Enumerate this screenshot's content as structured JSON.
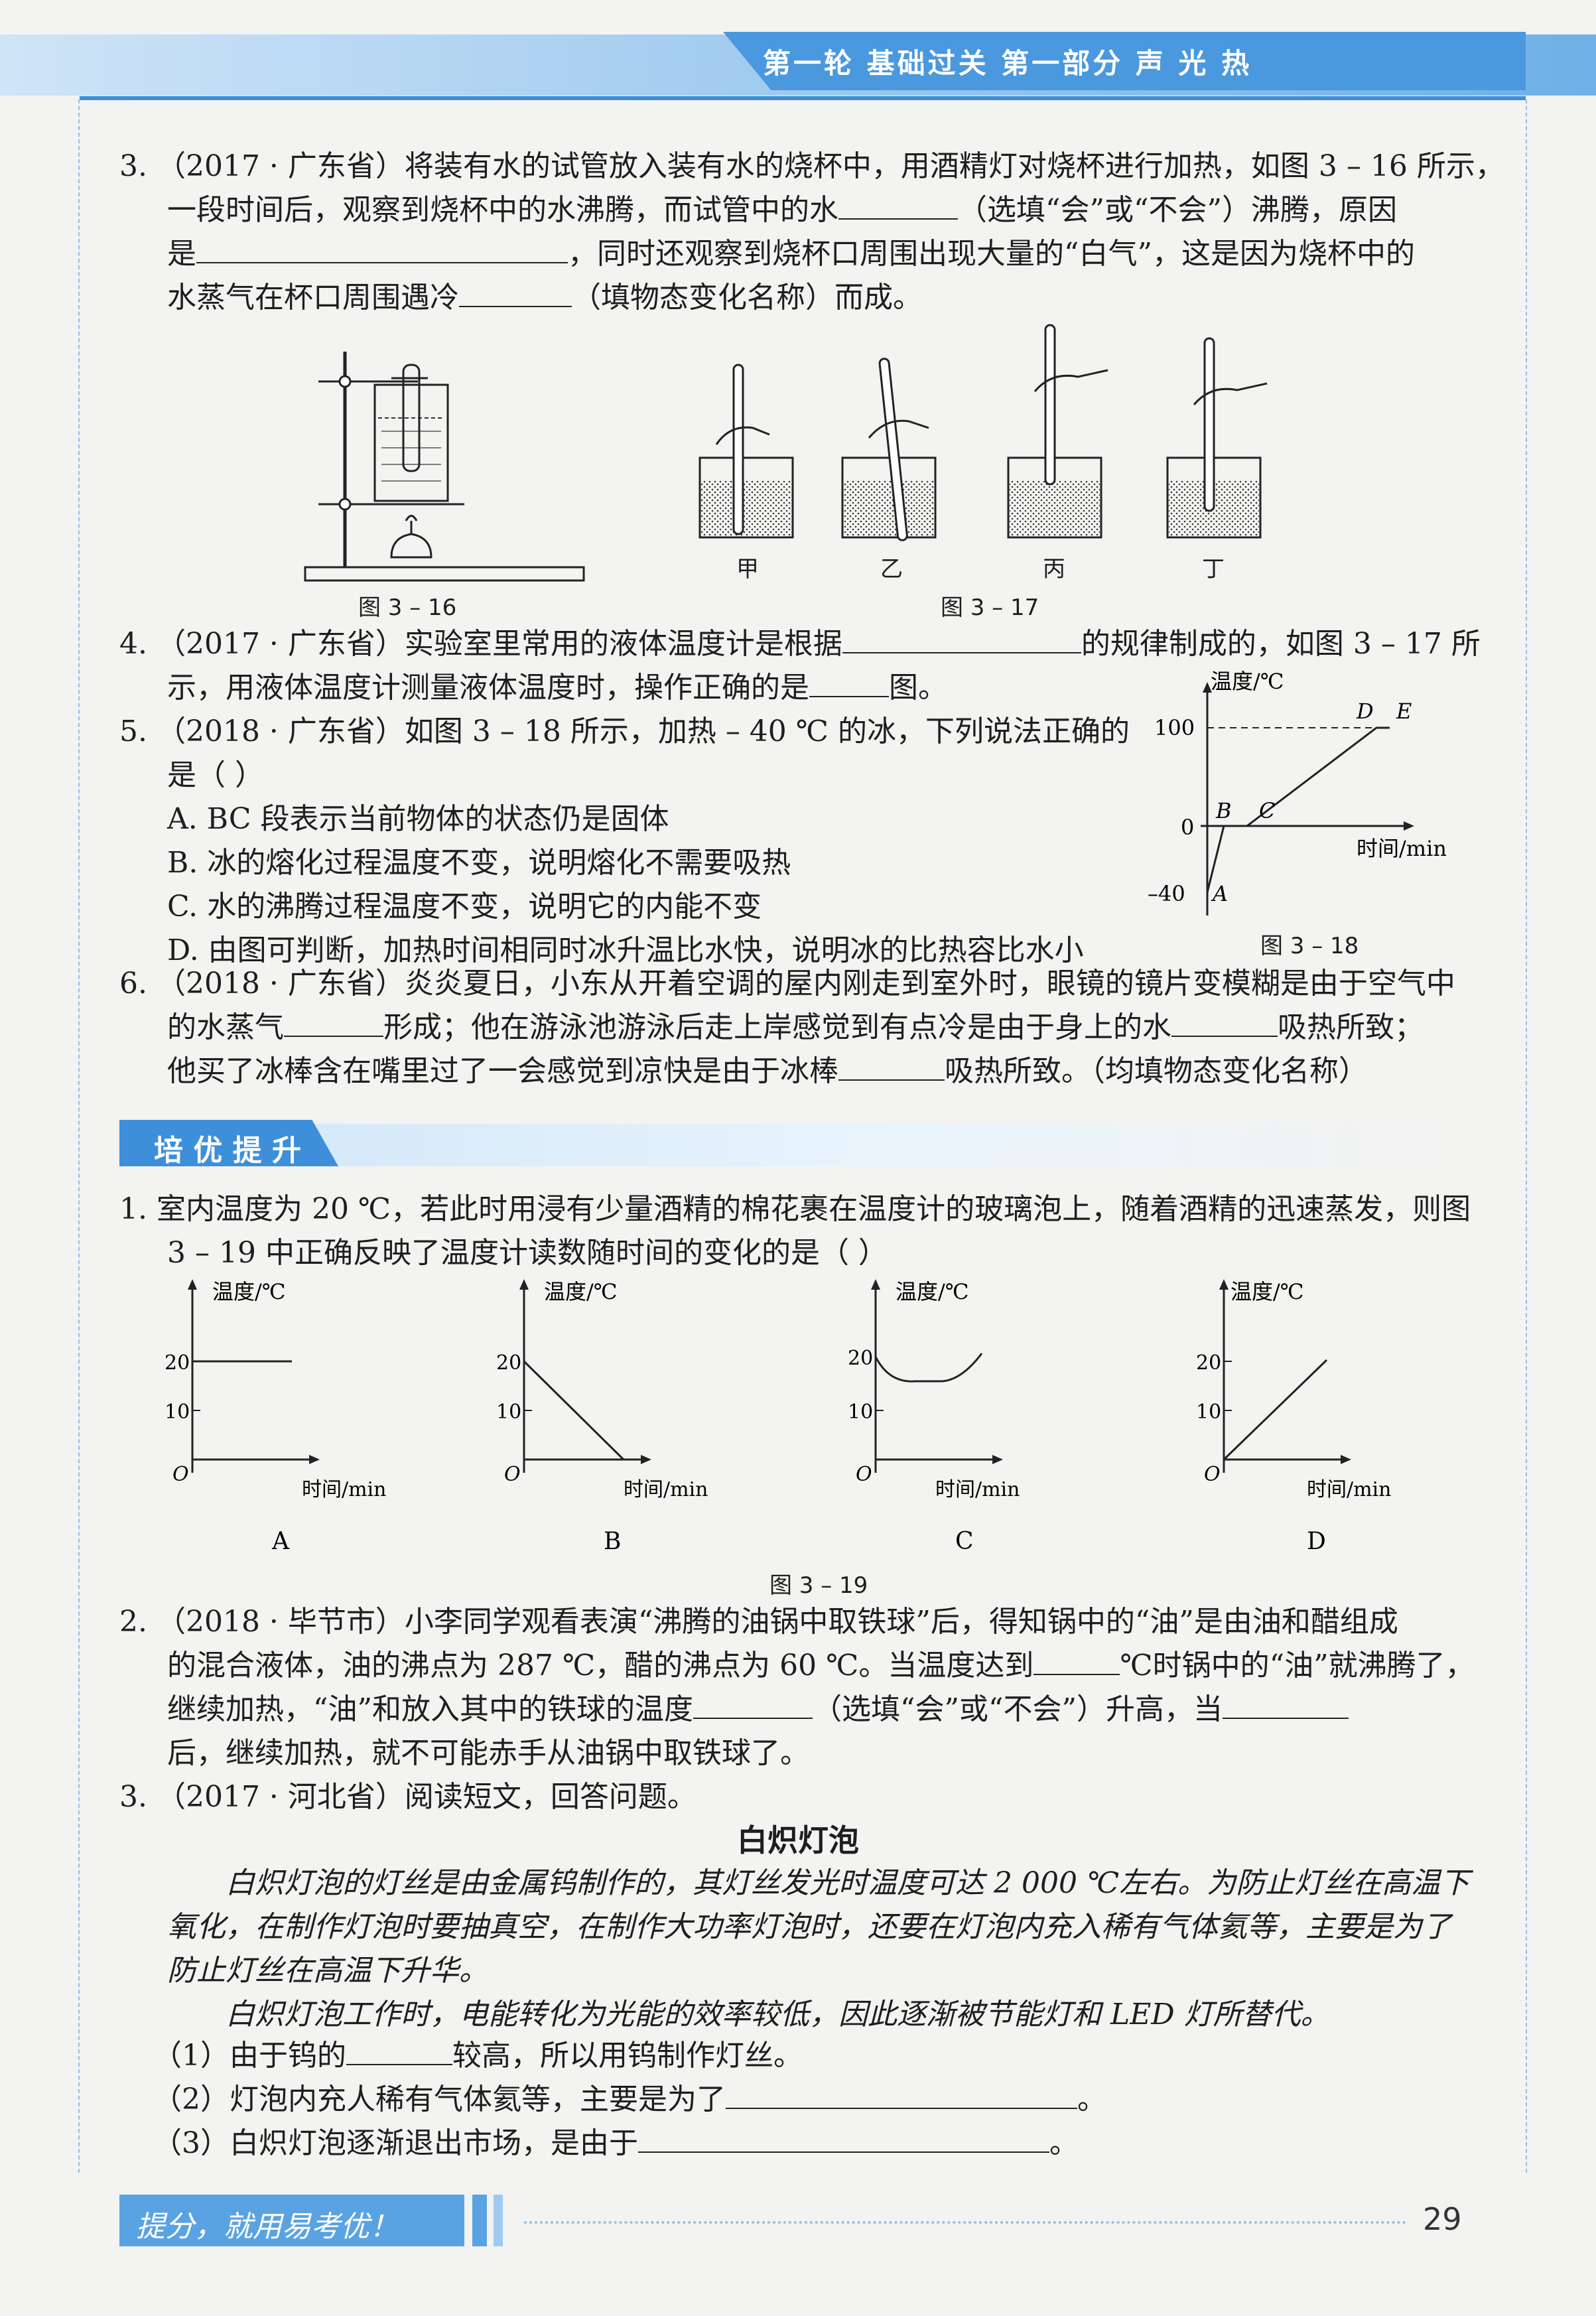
{
  "header": {
    "title": "第一轮  基础过关  第一部分  声  光  热"
  },
  "q3": {
    "l1": "3. （2017 · 广东省）将装有水的试管放入装有水的烧杯中，用酒精灯对烧杯进行加热，如图 3 – 16 所示，",
    "l2a": "一段时间后，观察到烧杯中的水沸腾，而试管中的水",
    "l2b": "（选填“会”或“不会”）沸腾，原因",
    "l3a": "是",
    "l3b": "，同时还观察到烧杯口周围出现大量的“白气”，这是因为烧杯中的",
    "l4a": "水蒸气在杯口周围遇冷",
    "l4b": "（填物态变化名称）而成。"
  },
  "fig316": {
    "caption": "图 3 – 16"
  },
  "fig317": {
    "caption": "图 3 – 17",
    "labels": [
      "甲",
      "乙",
      "丙",
      "丁"
    ]
  },
  "q4": {
    "l1a": "4. （2017 · 广东省）实验室里常用的液体温度计是根据",
    "l1b": "的规律制成的，如图 3 – 17 所",
    "l2a": "示，用液体温度计测量液体温度时，操作正确的是",
    "l2b": "图。"
  },
  "q5": {
    "l1": "5. （2018 · 广东省）如图 3 – 18 所示，加热 – 40 ℃ 的冰，下列说法正确的",
    "l2": "是（      ）",
    "options": [
      "A.  BC 段表示当前物体的状态仍是固体",
      "B.  冰的熔化过程温度不变，说明熔化不需要吸热",
      "C.  水的沸腾过程温度不变，说明它的内能不变",
      "D.  由图可判断，加热时间相同时冰升温比水快，说明冰的比热容比水小"
    ]
  },
  "fig318": {
    "caption": "图 3 – 18",
    "ylabel": "温度/℃",
    "xlabel": "时间/min",
    "ticks": [
      "100",
      "0",
      "–40"
    ],
    "points": [
      "A",
      "B",
      "C",
      "D",
      "E"
    ]
  },
  "q6": {
    "l1": "6. （2018 · 广东省）炎炎夏日，小东从开着空调的屋内刚走到室外时，眼镜的镜片变模糊是由于空气中",
    "l2a": "的水蒸气",
    "l2b": "形成；他在游泳池游泳后走上岸感觉到有点冷是由于身上的水",
    "l2c": "吸热所致；",
    "l3a": "他买了冰棒含在嘴里过了一会感觉到凉快是由于冰棒",
    "l3b": "吸热所致。（均填物态变化名称）"
  },
  "section": {
    "title": "培 优 提 升"
  },
  "p1": {
    "l1": "1.  室内温度为 20 ℃，若此时用浸有少量酒精的棉花裹在温度计的玻璃泡上，随着酒精的迅速蒸发，则图",
    "l2": "3 – 19 中正确反映了温度计读数随时间的变化的是（      ）"
  },
  "fig319": {
    "caption": "图 3 – 19",
    "ylabel": "温度/℃",
    "xlabel": "时间/min",
    "origin": "O",
    "ticks": [
      "20",
      "10"
    ],
    "options": [
      "A",
      "B",
      "C",
      "D"
    ]
  },
  "p2": {
    "l1": "2. （2018 · 毕节市）小李同学观看表演“沸腾的油锅中取铁球”后，得知锅中的“油”是由油和醋组成",
    "l2a": "的混合液体，油的沸点为 287 ℃，醋的沸点为 60 ℃。当温度达到",
    "l2b": "℃时锅中的“油”就沸腾了，",
    "l3a": "继续加热，“油”和放入其中的铁球的温度",
    "l3b": "（选填“会”或“不会”）升高，当",
    "l4": "后，继续加热，就不可能赤手从油锅中取铁球了。"
  },
  "p3": {
    "l1": "3. （2017 · 河北省）阅读短文，回答问题。",
    "title": "白炽灯泡",
    "para1a": "白炽灯泡的灯丝是由金属钨制作的，其灯丝发光时温度可达 2 000 ℃左右。为防止灯丝在高温下",
    "para1b": "氧化，在制作灯泡时要抽真空，在制作大功率灯泡时，还要在灯泡内充入稀有气体氦等，主要是为了",
    "para1c": "防止灯丝在高温下升华。",
    "para2": "白炽灯泡工作时，电能转化为光能的效率较低，因此逐渐被节能灯和 LED 灯所替代。",
    "s1a": "（1）由于钨的",
    "s1b": "较高，所以用钨制作灯丝。",
    "s2a": "（2）灯泡内充人稀有气体氦等，主要是为了",
    "s2b": "。",
    "s3a": "（3）白炽灯泡逐渐退出市场，是由于",
    "s3b": "。"
  },
  "footer": {
    "slogan": "提分，就用易考优！",
    "page_number": "29"
  },
  "colors": {
    "accent": "#3d8fd9",
    "accent_light": "#9fcbf2",
    "header_text": "#ffffff"
  }
}
